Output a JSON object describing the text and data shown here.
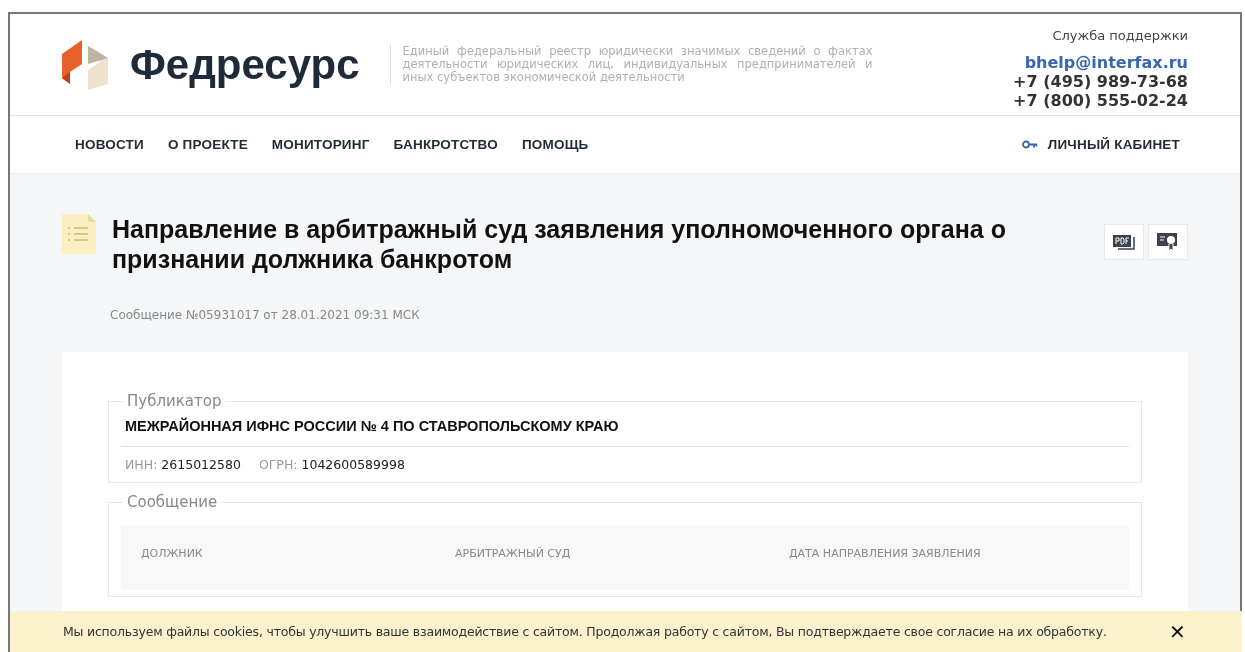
{
  "header": {
    "logo_text": "Федресурс",
    "tagline": "Единый федеральный реестр юридически значимых сведений о фактах деятельности юридических лиц, индивидуальных предпринимателей и иных субъектов экономической деятельности",
    "support_label": "Служба поддержки",
    "email": "bhelp@interfax.ru",
    "phones": [
      "+7 (495) 989-73-68",
      "+7 (800) 555-02-24"
    ]
  },
  "nav": {
    "items": [
      "НОВОСТИ",
      "О ПРОЕКТЕ",
      "МОНИТОРИНГ",
      "БАНКРОТСТВО",
      "ПОМОЩЬ"
    ],
    "account": "ЛИЧНЫЙ КАБИНЕТ"
  },
  "document": {
    "title": "Направление в арбитражный суд заявления уполномоченного органа о признании должника банкротом",
    "meta": "Сообщение №05931017 от 28.01.2021 09:31 МСК"
  },
  "publisher": {
    "legend": "Публикатор",
    "name": "МЕЖРАЙОННАЯ ИФНС РОССИИ № 4 ПО СТАВРОПОЛЬСКОМУ КРАЮ",
    "ids": [
      {
        "label": "ИНН:",
        "value": "2615012580"
      },
      {
        "label": "ОГРН:",
        "value": "1042600589998"
      }
    ]
  },
  "message": {
    "legend": "Сообщение",
    "columns": [
      "ДОЛЖНИК",
      "АРБИТРАЖНЫЙ СУД",
      "ДАТА НАПРАВЛЕНИЯ ЗАЯВЛЕНИЯ"
    ]
  },
  "cookie_bar": {
    "text": "Мы используем файлы cookies, чтобы улучшить ваше взаимодействие с сайтом. Продолжая работу с сайтом, Вы подтверждаете свое согласие на их обработку.",
    "close": "✕"
  }
}
